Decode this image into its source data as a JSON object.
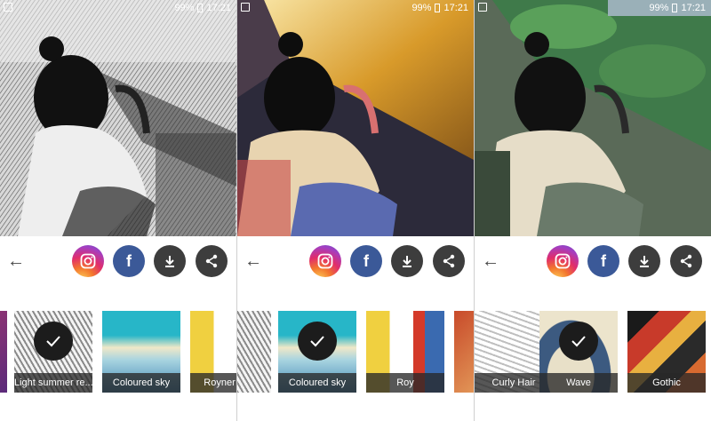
{
  "status": {
    "time": "17:21",
    "battery": "99%"
  },
  "actions": {
    "back_glyph": "←",
    "facebook_glyph": "f"
  },
  "panels": [
    {
      "style": "sketch",
      "thumbs": [
        {
          "label": "",
          "selected": false
        },
        {
          "label": "Light summer re...",
          "selected": true
        },
        {
          "label": "Coloured sky",
          "selected": false
        },
        {
          "label": "Royner re...",
          "selected": false
        }
      ]
    },
    {
      "style": "coloured-sky",
      "thumbs": [
        {
          "label": "",
          "selected": false
        },
        {
          "label": "Coloured sky",
          "selected": true
        },
        {
          "label": "Roy",
          "selected": false
        },
        {
          "label": "",
          "selected": false
        }
      ]
    },
    {
      "style": "wave",
      "thumbs": [
        {
          "label": "Curly Hair",
          "selected": false
        },
        {
          "label": "Wave",
          "selected": true
        },
        {
          "label": "Gothic",
          "selected": false
        }
      ]
    }
  ],
  "colors": {
    "instagram": "#e12d6b",
    "facebook": "#3b5998",
    "dark_button": "#3d3d3d"
  }
}
